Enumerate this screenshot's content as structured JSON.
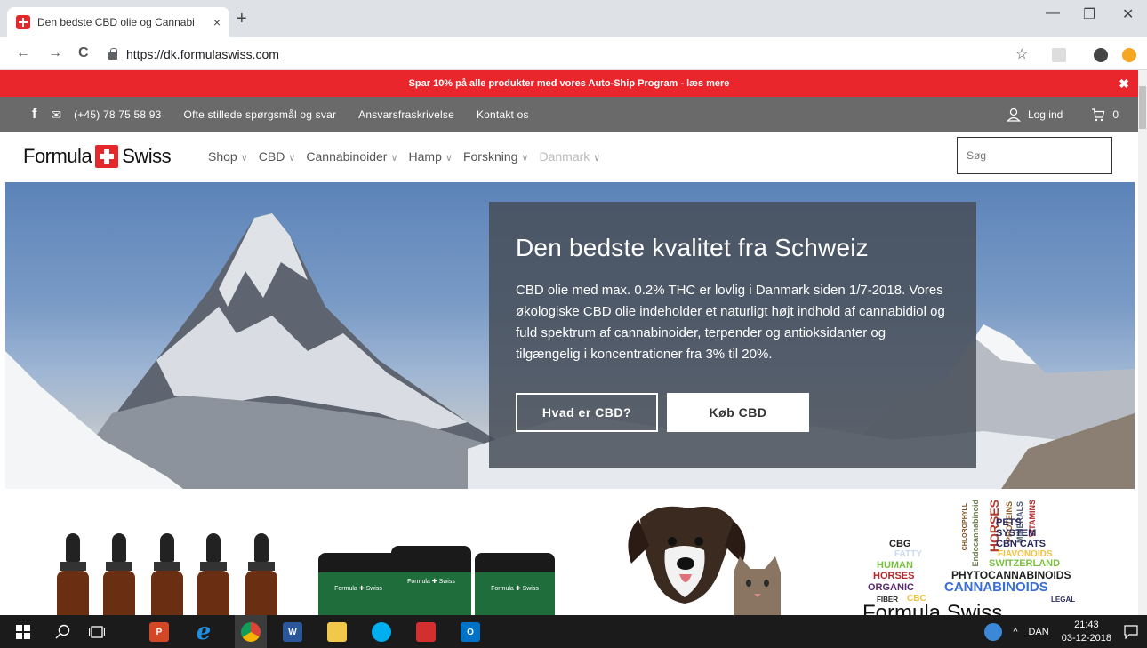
{
  "browser": {
    "tab_title": "Den bedste CBD olie og Cannabi",
    "tab_close": "×",
    "new_tab": "+",
    "url": "https://dk.formulaswiss.com",
    "back": "←",
    "forward": "→",
    "reload": "C",
    "bookmark": "☆",
    "minimize": "—",
    "restore": "❐",
    "close": "✕"
  },
  "promo": {
    "text": "Spar 10% på alle produkter med vores Auto-Ship Program - læs mere",
    "close": "✖"
  },
  "topnav": {
    "facebook": "f",
    "mail": "✉",
    "phone": "(+45) 78 75 58 93",
    "items": [
      "Ofte stillede spørgsmål og svar",
      "Ansvarsfraskrivelse",
      "Kontakt os"
    ],
    "login": "Log ind",
    "cart_count": "0"
  },
  "brand": {
    "left": "Formula",
    "right": "Swiss"
  },
  "menu": {
    "items": [
      "Shop",
      "CBD",
      "Cannabinoider",
      "Hamp",
      "Forskning",
      "Danmark"
    ],
    "chevron": "∨"
  },
  "search": {
    "placeholder": "Søg"
  },
  "hero": {
    "title": "Den bedste kvalitet fra Schweiz",
    "body": "CBD olie med max. 0.2% THC er lovlig i Danmark siden 1/7-2018. Vores økologiske CBD olie indeholder et naturligt højt indhold af cannabidiol og fuld spektrum af cannabinoider, terpender og antioksidanter og tilgængelig i koncentrationer fra 3% til 20%.",
    "btn_primary": "Hvad er CBD?",
    "btn_secondary": "Køb CBD"
  },
  "products": {
    "jar_label": "Formula ✚ Swiss",
    "bottle_label": "Formula Swiss"
  },
  "wordcloud": {
    "words": [
      "PETS",
      "SYSTEM",
      "CBN CATS",
      "FIAVONOIDS",
      "SWITZERLAND",
      "PHYTOCANNABINOIDS",
      "CANNABINOIDS",
      "CBG",
      "FATTY",
      "HUMAN",
      "HORSES",
      "ORGANIC",
      "FIBER",
      "CBC",
      "LEGAL",
      "HORSES",
      "PROTEINS",
      "MINERALS",
      "VITAMINS",
      "Endocannabinoid",
      "CHLOROPHYLL"
    ],
    "brand": "Formula Swiss"
  },
  "taskbar": {
    "lang": "DAN",
    "time": "21:43",
    "date": "03-12-2018",
    "up": "^",
    "icons": {
      "word": "W",
      "ppt": "P",
      "outlook": "O"
    }
  },
  "colors": {
    "brand_red": "#e8262b",
    "topnav_grey": "#6a6a6a",
    "panel": "#464e58",
    "taskbar": "#1b1b1b"
  }
}
